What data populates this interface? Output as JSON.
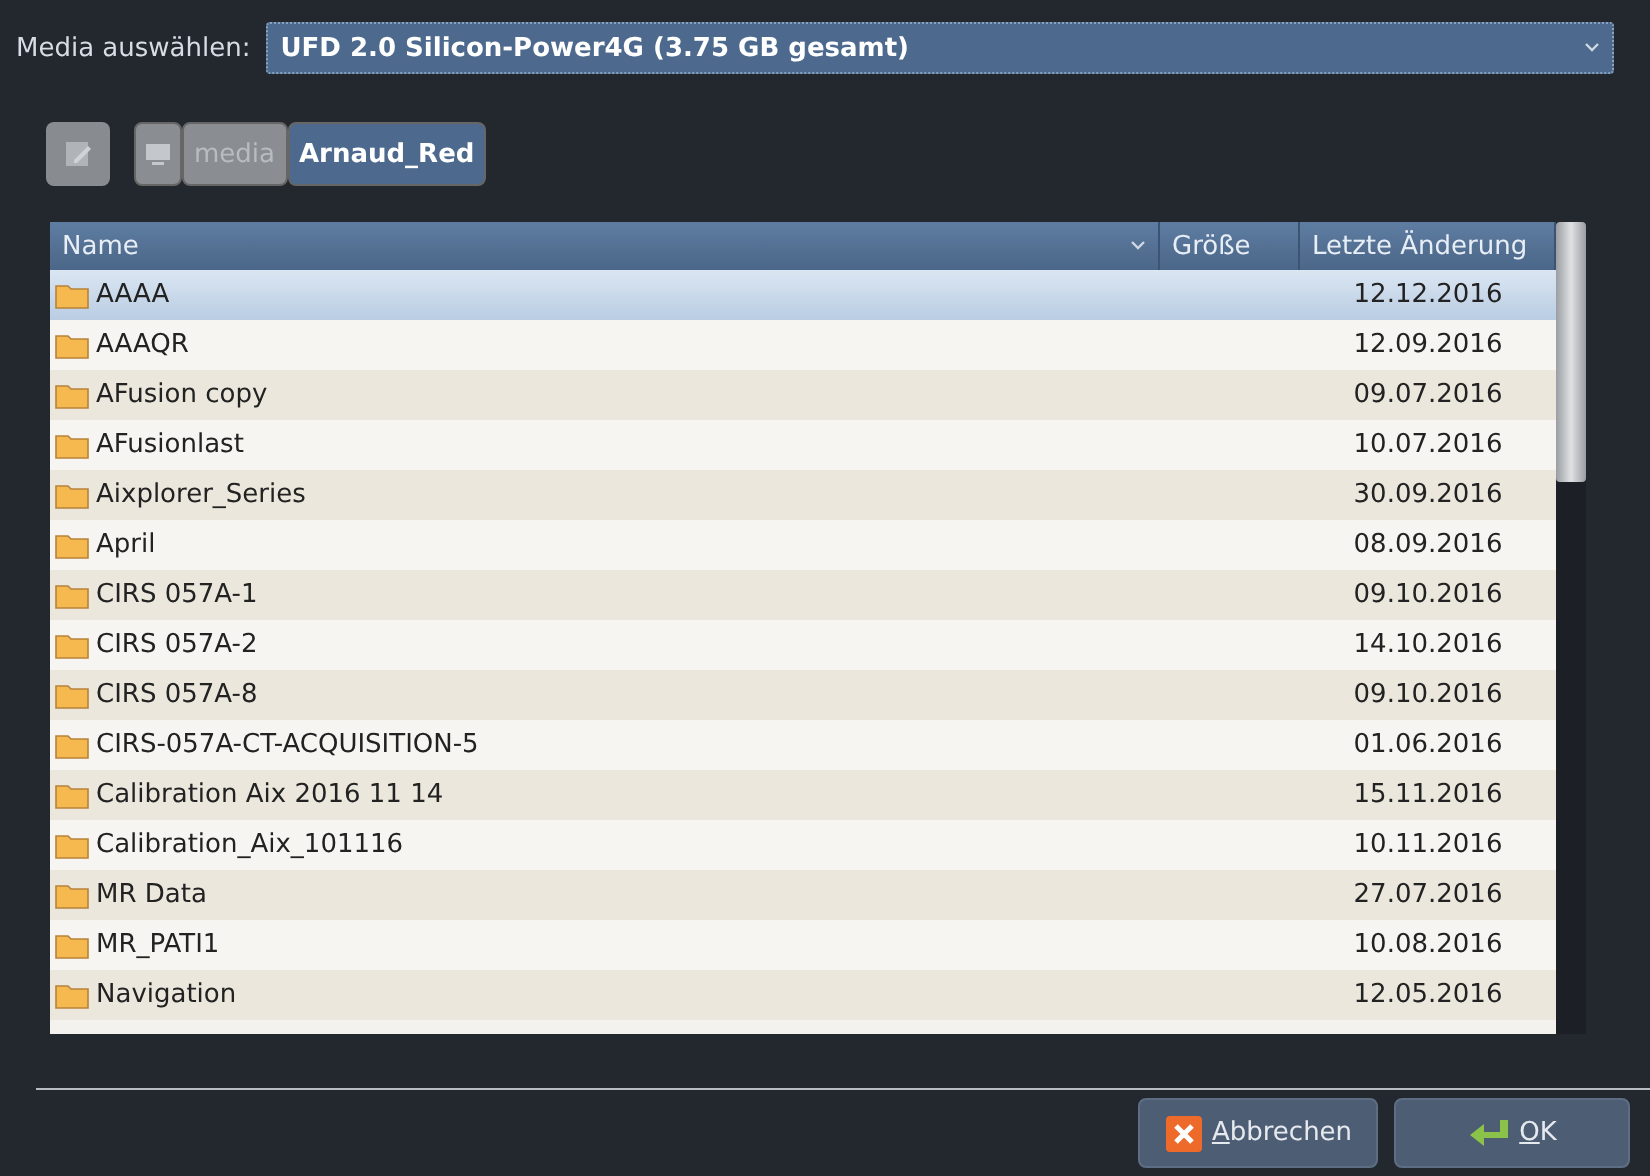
{
  "media_select": {
    "label": "Media auswählen:",
    "value": "UFD 2.0 Silicon-Power4G (3.75 GB gesamt)"
  },
  "path": [
    {
      "kind": "icon",
      "selected": false
    },
    {
      "kind": "text",
      "label": "media",
      "selected": false
    },
    {
      "kind": "text",
      "label": "Arnaud_Red",
      "selected": true
    }
  ],
  "table": {
    "columns": [
      "Name",
      "Größe",
      "Letzte Änderung"
    ],
    "rows": [
      {
        "name": "AAAA",
        "date": "12.12.2016",
        "selected": true
      },
      {
        "name": "AAAQR",
        "date": "12.09.2016",
        "selected": false
      },
      {
        "name": "AFusion copy",
        "date": "09.07.2016",
        "selected": false
      },
      {
        "name": "AFusionlast",
        "date": "10.07.2016",
        "selected": false
      },
      {
        "name": "Aixplorer_Series",
        "date": "30.09.2016",
        "selected": false
      },
      {
        "name": "April",
        "date": "08.09.2016",
        "selected": false
      },
      {
        "name": "CIRS 057A-1",
        "date": "09.10.2016",
        "selected": false
      },
      {
        "name": "CIRS 057A-2",
        "date": "14.10.2016",
        "selected": false
      },
      {
        "name": "CIRS 057A-8",
        "date": "09.10.2016",
        "selected": false
      },
      {
        "name": "CIRS-057A-CT-ACQUISITION-5",
        "date": "01.06.2016",
        "selected": false
      },
      {
        "name": "Calibration Aix 2016 11 14",
        "date": "15.11.2016",
        "selected": false
      },
      {
        "name": "Calibration_Aix_101116",
        "date": "10.11.2016",
        "selected": false
      },
      {
        "name": "MR Data",
        "date": "27.07.2016",
        "selected": false
      },
      {
        "name": "MR_PATI1",
        "date": "10.08.2016",
        "selected": false
      },
      {
        "name": "Navigation",
        "date": "12.05.2016",
        "selected": false
      }
    ]
  },
  "buttons": [
    {
      "kind": "cancel",
      "label": "Abbrechen"
    },
    {
      "kind": "ok",
      "label": "OK"
    }
  ]
}
